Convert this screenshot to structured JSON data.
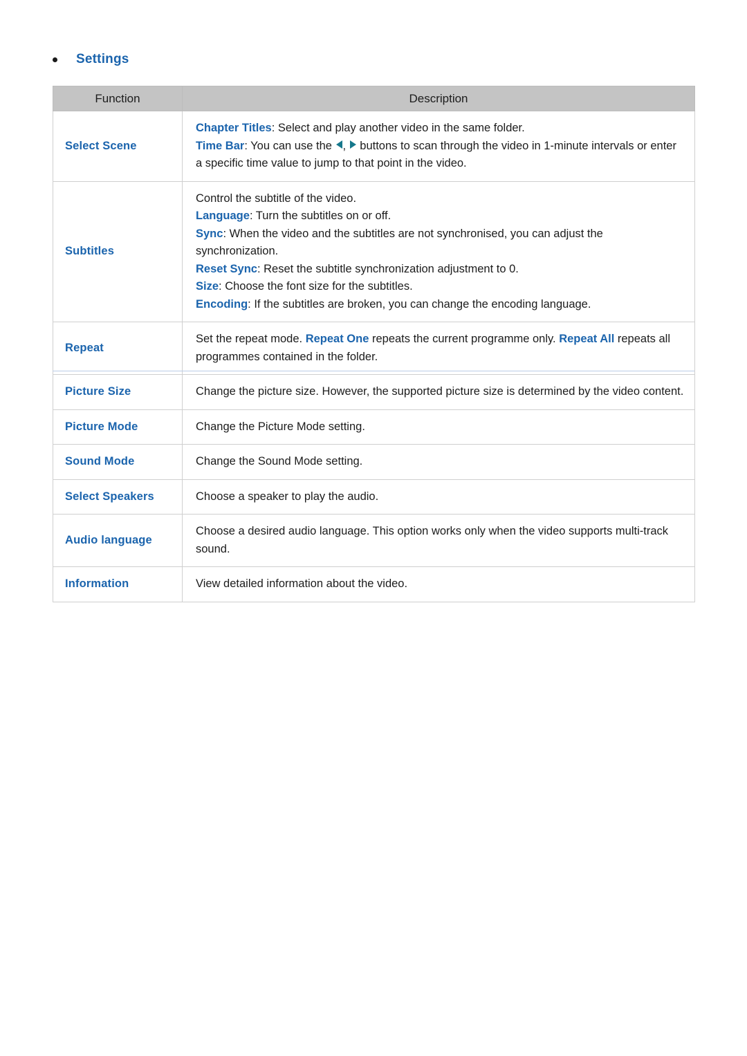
{
  "heading": {
    "bullet": "•",
    "title": "Settings"
  },
  "table": {
    "columns": [
      {
        "header": "Function"
      },
      {
        "header": "Description"
      }
    ],
    "rows": [
      {
        "function": "Select Scene",
        "lines": [
          {
            "keyword": "Chapter Titles",
            "text": ": Select and play another video in the same folder."
          },
          {
            "keyword": "Time Bar",
            "text_before_arrows": ": You can use the ",
            "arrows": [
              "arrow-left-icon",
              "arrow-right-icon"
            ],
            "text_after_arrows": " buttons to scan through the video in 1-minute intervals or enter a specific time value to jump to that point in the video."
          }
        ]
      },
      {
        "function": "Subtitles",
        "lines": [
          {
            "keyword": "",
            "text": "Control the subtitle of the video."
          },
          {
            "keyword": "Language",
            "text": ": Turn the subtitles on or off."
          },
          {
            "keyword": "Sync",
            "text": ": When the video and the subtitles are not synchronised, you can adjust the synchronization."
          },
          {
            "keyword": "Reset Sync",
            "text": ": Reset the subtitle synchronization adjustment to 0."
          },
          {
            "keyword": "Size",
            "text": ": Choose the font size for the subtitles."
          },
          {
            "keyword": "Encoding",
            "text": ": If the subtitles are broken, you can change the encoding language."
          }
        ]
      },
      {
        "function": "Repeat",
        "repeat_text_1": "Set the repeat mode. ",
        "repeat_kw_1": "Repeat One",
        "repeat_text_2": " repeats the current programme only. ",
        "repeat_kw_2": "Repeat All",
        "repeat_text_3": " repeats all programmes contained in the folder."
      },
      {
        "function": "Picture Size",
        "description": "Change the picture size. However, the supported picture size is determined by the video content."
      },
      {
        "function": "Picture Mode",
        "description": "Change the Picture Mode setting."
      },
      {
        "function": "Sound Mode",
        "description": "Change the Sound Mode setting."
      },
      {
        "function": "Select Speakers",
        "description": "Choose a speaker to play the audio."
      },
      {
        "function": "Audio language",
        "description": "Choose a desired audio language. This option works only when the video supports multi-track sound."
      },
      {
        "function": "Information",
        "description": "View detailed information about the video."
      }
    ]
  },
  "colors": {
    "accent_blue": "#1b64ad",
    "header_gray": "#c4c4c4",
    "border_gray": "#cfcfcf",
    "arrow_teal": "#16788c",
    "page_break_blue": "#b9cbe6",
    "body_text": "#1c1c1c"
  }
}
